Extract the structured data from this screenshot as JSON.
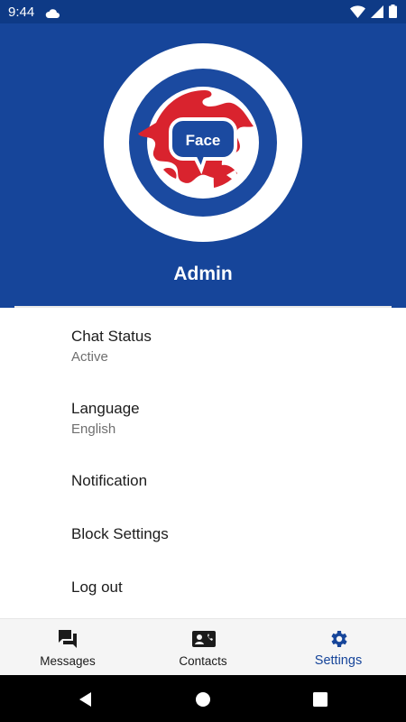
{
  "status_bar": {
    "time": "9:44",
    "icons": [
      "cloud-icon",
      "wifi-icon",
      "signal-icon",
      "battery-icon"
    ]
  },
  "profile": {
    "logo_text": "Face",
    "name": "Admin"
  },
  "settings": [
    {
      "title": "Chat Status",
      "subtitle": "Active"
    },
    {
      "title": "Language",
      "subtitle": "English"
    },
    {
      "title": "Notification"
    },
    {
      "title": "Block Settings"
    },
    {
      "title": "Log out"
    }
  ],
  "bottom_nav": {
    "items": [
      {
        "label": "Messages",
        "icon": "messages-icon",
        "active": false
      },
      {
        "label": "Contacts",
        "icon": "contacts-icon",
        "active": false
      },
      {
        "label": "Settings",
        "icon": "gear-icon",
        "active": true
      }
    ]
  },
  "system_nav": [
    "back-icon",
    "home-icon",
    "recents-icon"
  ],
  "colors": {
    "primary": "#16459a",
    "status_bar": "#0e3a86",
    "globe_red": "#d9232e",
    "text": "#1c1c1c",
    "subtext": "#6f6f6f",
    "nav_bg": "#f5f5f5"
  }
}
